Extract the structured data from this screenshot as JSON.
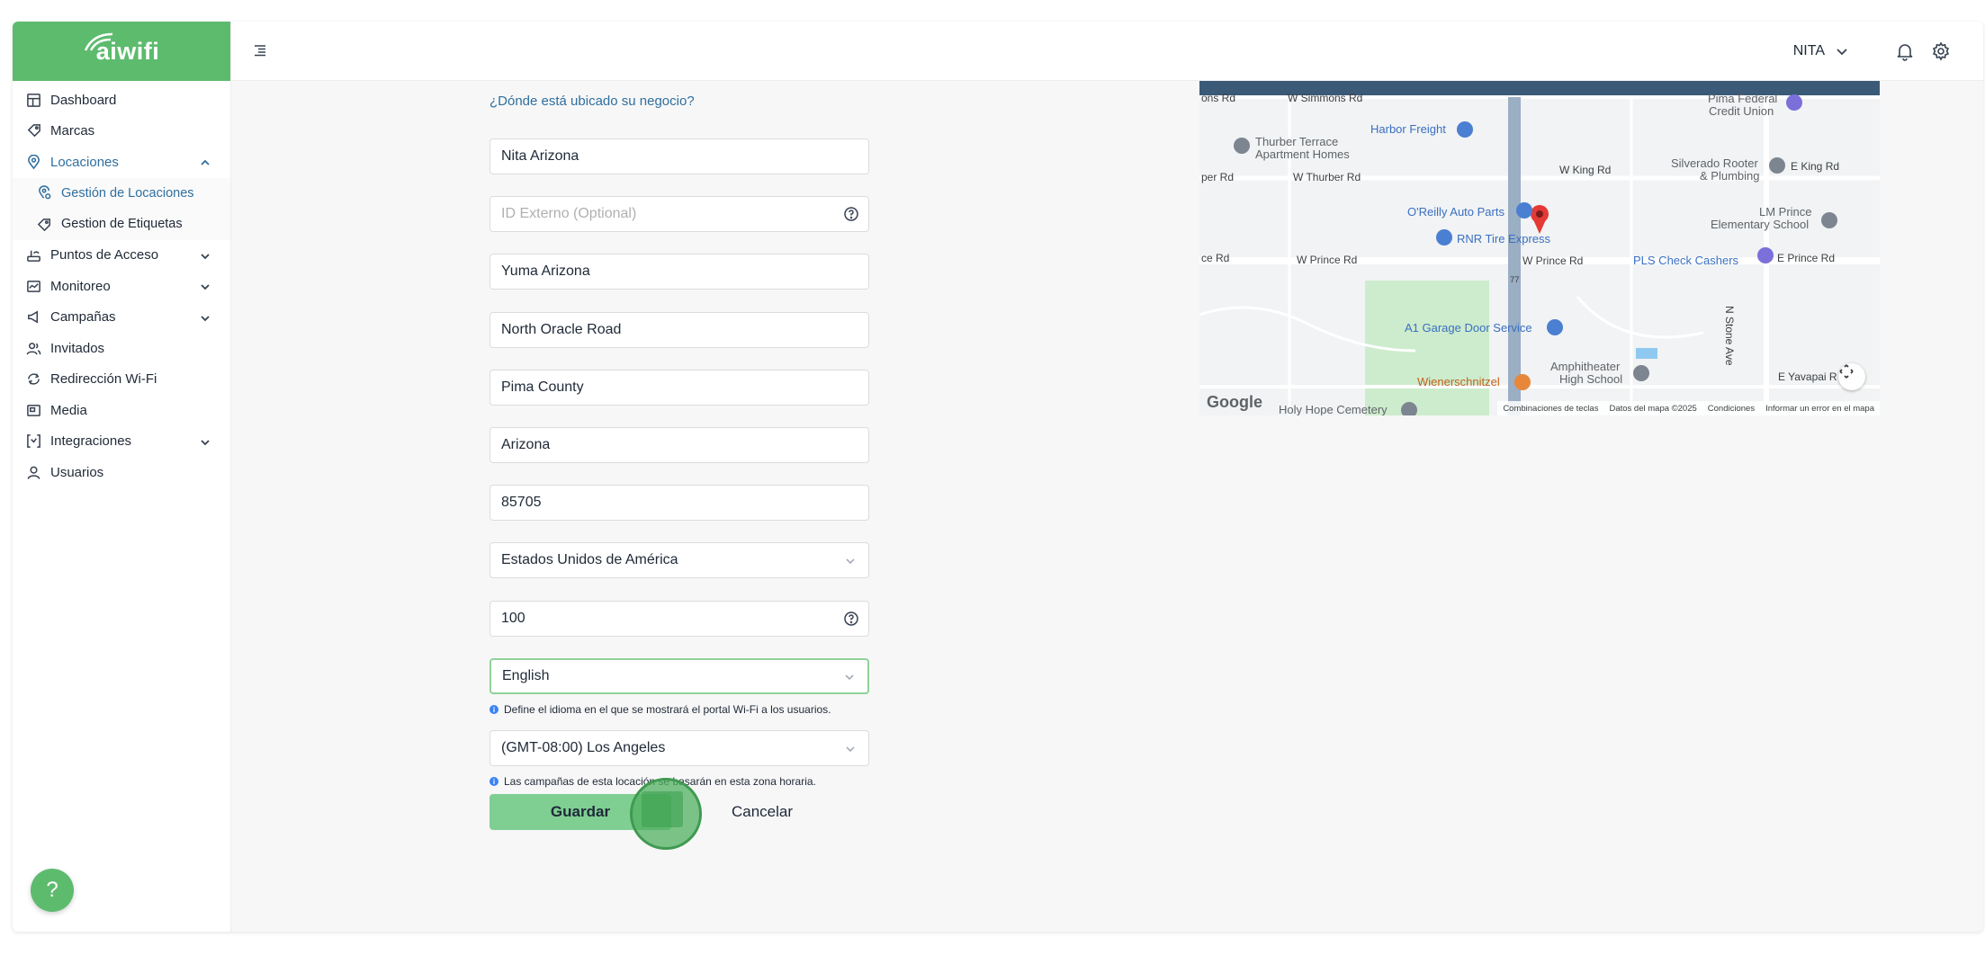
{
  "brand": {
    "name": "aiwifi",
    "color": "#5dbb6e"
  },
  "header": {
    "user": "NITA",
    "icons": [
      "menu-icon",
      "bell-icon",
      "gear-icon"
    ]
  },
  "sidebar": {
    "items": [
      {
        "label": "Dashboard",
        "icon": "dashboard-icon"
      },
      {
        "label": "Marcas",
        "icon": "tag-icon"
      },
      {
        "label": "Locaciones",
        "icon": "location-pin-icon",
        "expanded": true
      },
      {
        "label": "Puntos de Acceso",
        "icon": "router-icon"
      },
      {
        "label": "Monitoreo",
        "icon": "monitor-icon"
      },
      {
        "label": "Campañas",
        "icon": "megaphone-icon"
      },
      {
        "label": "Invitados",
        "icon": "users-icon"
      },
      {
        "label": "Redirección Wi-Fi",
        "icon": "redirect-icon"
      },
      {
        "label": "Media",
        "icon": "media-icon"
      },
      {
        "label": "Integraciones",
        "icon": "integrations-icon"
      },
      {
        "label": "Usuarios",
        "icon": "user-icon"
      }
    ],
    "sub_items": [
      {
        "label": "Gestión de Locaciones",
        "icon": "location-settings-icon"
      },
      {
        "label": "Gestion de Etiquetas",
        "icon": "label-icon"
      }
    ],
    "help": "?"
  },
  "form": {
    "section_label": "¿Dónde está ubicado su negocio?",
    "name": "Nita Arizona",
    "external_id_placeholder": "ID Externo (Optional)",
    "city": "Yuma Arizona",
    "address": "North Oracle Road",
    "county": "Pima County",
    "state": "Arizona",
    "zip": "85705",
    "country": "Estados Unidos de América",
    "radius": "100",
    "language": "English",
    "language_hint": "Define el idioma en el que se mostrará el portal Wi-Fi a los usuarios.",
    "timezone": "(GMT-08:00) Los Angeles",
    "timezone_hint": "Las campañas de esta locación se basarán en esta zona horaria.",
    "save": "Guardar",
    "cancel": "Cancelar"
  },
  "map": {
    "labels": {
      "simmons_left": "ons Rd",
      "simmons": "W Simmons Rd",
      "harbor": "Harbor Freight",
      "pima_credit": "Pima Federal",
      "pima_credit2": "Credit Union",
      "thurber_terrace": "Thurber Terrace",
      "thurber_terrace2": "Apartment Homes",
      "king_rd": "W King Rd",
      "silverado": "Silverado Rooter",
      "silverado2": "& Plumbing",
      "e_king": "E King Rd",
      "per_rd": "per Rd",
      "thurber_rd": "W Thurber Rd",
      "oreilly": "O'Reilly Auto Parts",
      "lm_prince": "LM Prince",
      "lm_prince2": "Elementary School",
      "rnr": "RNR Tire Express",
      "ce_rd": "ce Rd",
      "w_prince_left": "W Prince Rd",
      "w_prince": "W Prince Rd",
      "pls": "PLS Check Cashers",
      "e_prince": "E Prince Rd",
      "route": "77",
      "stone": "N Stone Ave",
      "a1": "A1 Garage Door Service",
      "amphi": "Amphitheater",
      "amphi2": "High School",
      "wiener": "Wienerschnitzel",
      "yavapai": "E Yavapai R",
      "holy": "Holy Hope Cemetery"
    },
    "google": "Google",
    "footer": [
      "Combinaciones de teclas",
      "Datos del mapa ©2025",
      "Condiciones",
      "Informar un error en el mapa"
    ]
  }
}
